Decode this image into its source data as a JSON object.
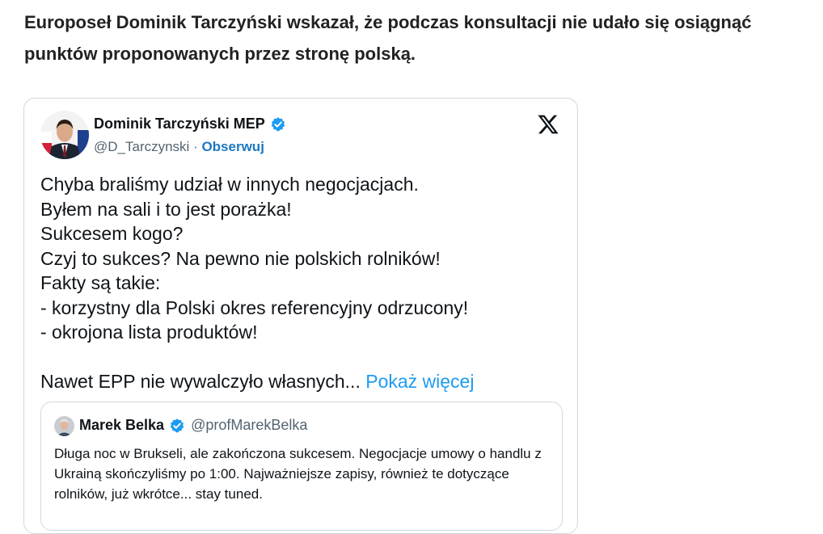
{
  "article": {
    "lead": "Europoseł Dominik Tarczyński wskazał, że podczas konsultacji nie udało się osiągnąć punktów proponowanych przez stronę polską."
  },
  "tweet": {
    "author_name": "Dominik Tarczyński MEP",
    "handle": "@D_Tarczynski",
    "separator": " · ",
    "follow_label": "Obserwuj",
    "lines": [
      "Chyba braliśmy udział w innych negocjacjach.",
      "Byłem na sali i to jest porażka!",
      "Sukcesem kogo?",
      "Czyj to sukces? Na pewno nie polskich rolników!",
      "Fakty są takie:",
      "- korzystny dla Polski okres referencyjny odrzucony!",
      "- okrojona lista produktów!"
    ],
    "last_line": "Nawet EPP nie wywalczyło własnych...",
    "show_more_label": "Pokaż więcej",
    "icons": {
      "verified": "verified-badge-icon",
      "platform": "x-logo-icon"
    },
    "colors": {
      "verified": "#1d9bf0",
      "link": "#1d9bf0",
      "follow": "#1d77c2"
    }
  },
  "quoted_tweet": {
    "author_name": "Marek Belka",
    "handle": "@profMarekBelka",
    "text": "Długa noc w Brukseli, ale zakończona sukcesem. Negocjacje umowy o handlu z Ukrainą skończyliśmy po 1:00. Najważniejsze zapisy, również te dotyczące rolników, już wkrótce... stay tuned."
  }
}
